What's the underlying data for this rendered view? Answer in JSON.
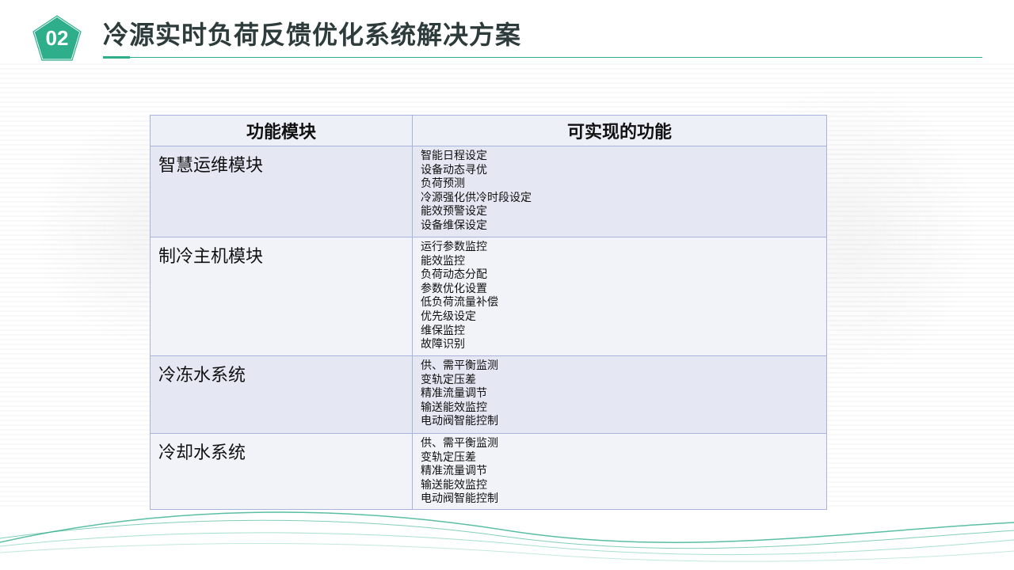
{
  "header": {
    "number": "02",
    "title": "冷源实时负荷反馈优化系统解决方案"
  },
  "table": {
    "headers": [
      "功能模块",
      "可实现的功能"
    ],
    "rows": [
      {
        "module": "智慧运维模块",
        "functions": [
          "智能日程设定",
          "设备动态寻优",
          "负荷预测",
          "冷源强化供冷时段设定",
          "能效预警设定",
          "设备维保设定"
        ]
      },
      {
        "module": "制冷主机模块",
        "functions": [
          "运行参数监控",
          "能效监控",
          "负荷动态分配",
          "参数优化设置",
          "低负荷流量补偿",
          "优先级设定",
          "维保监控",
          "故障识别"
        ]
      },
      {
        "module": "冷冻水系统",
        "functions": [
          "供、需平衡监测",
          "变轨定压差",
          "精准流量调节",
          "输送能效监控",
          "电动阀智能控制"
        ]
      },
      {
        "module": "冷却水系统",
        "functions": [
          "供、需平衡监测",
          "变轨定压差",
          "精准流量调节",
          "输送能效监控",
          "电动阀智能控制"
        ]
      }
    ]
  },
  "colors": {
    "accent": "#2fae8c",
    "table_border": "#a9b4de",
    "row_odd": "#e5e7f3",
    "row_even": "#f2f3f9"
  }
}
